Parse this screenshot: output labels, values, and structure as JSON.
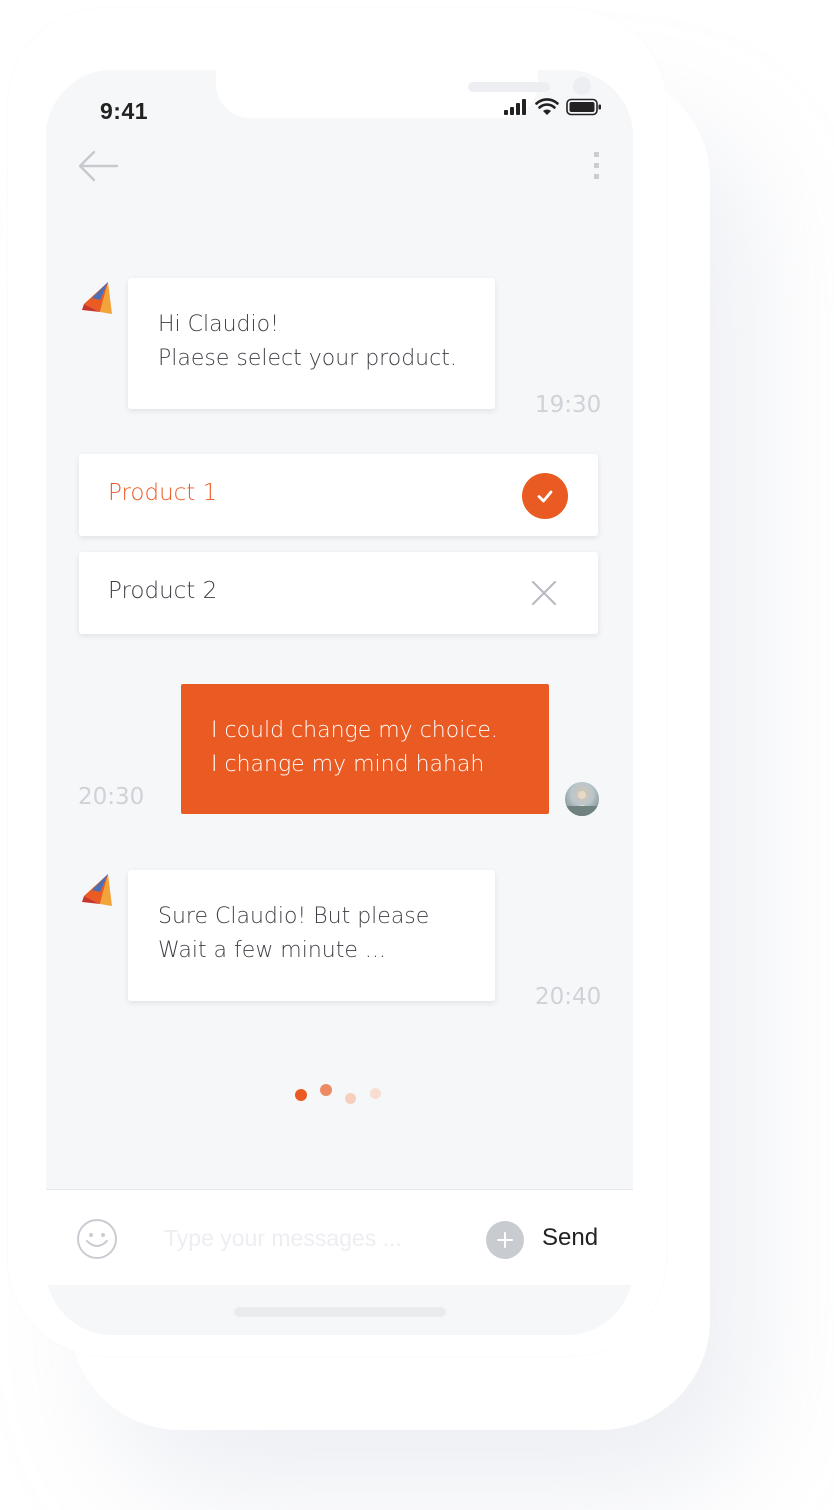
{
  "status_bar": {
    "time": "9:41"
  },
  "header": {
    "back_icon": "arrow-left-icon",
    "menu_icon": "more-vertical-icon"
  },
  "messages": [
    {
      "sender": "bot",
      "lines": [
        "Hi Claudio!",
        "Plaese select your product."
      ],
      "time": "19:30"
    },
    {
      "sender": "user",
      "lines": [
        "I could change my choice.",
        "I change my mind hahah"
      ],
      "time": "20:30"
    },
    {
      "sender": "bot",
      "lines": [
        "Sure Claudio! But please",
        "Wait a few minute ..."
      ],
      "time": "20:40"
    }
  ],
  "product_options": [
    {
      "label": "Product 1",
      "state": "selected",
      "icon": "check-circle-icon"
    },
    {
      "label": "Product 2",
      "state": "rejected",
      "icon": "close-icon"
    }
  ],
  "typing_indicator": {
    "dots": 4
  },
  "composer": {
    "placeholder": "Type your messages ...",
    "send_label": "Send",
    "emoji_icon": "emoji-icon",
    "add_icon": "plus-icon"
  },
  "colors": {
    "accent": "#ea5b24",
    "background": "#f6f7f9",
    "timestamp": "#cfd2d8",
    "text": "#3c3f45"
  }
}
